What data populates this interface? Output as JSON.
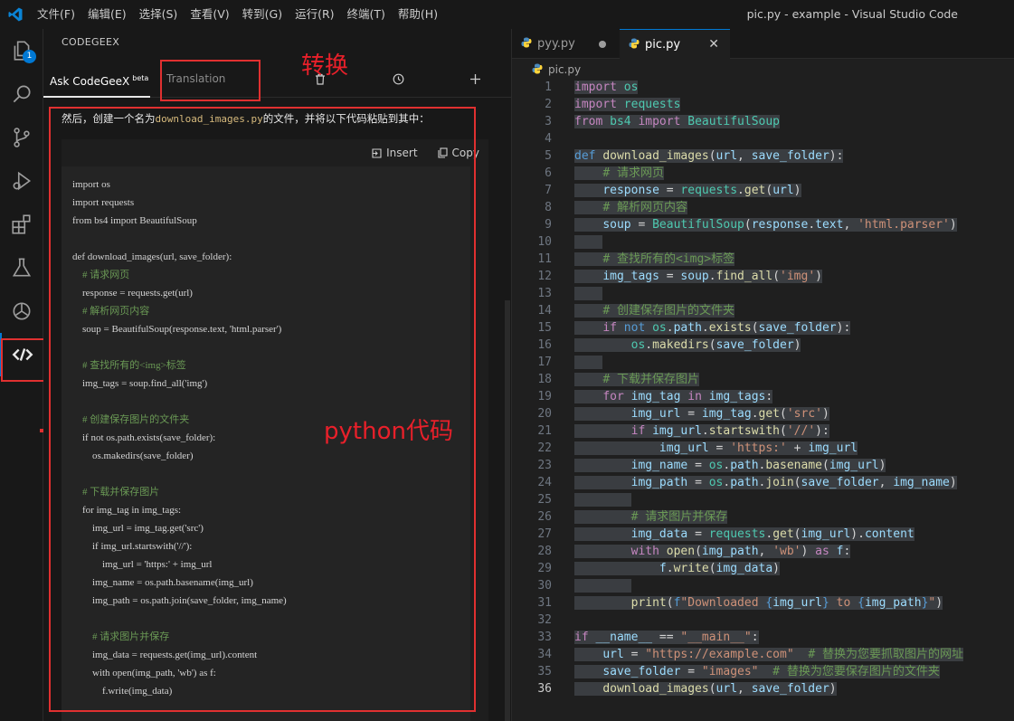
{
  "titlebar": {
    "menus": [
      "文件(F)",
      "编辑(E)",
      "选择(S)",
      "查看(V)",
      "转到(G)",
      "运行(R)",
      "终端(T)",
      "帮助(H)"
    ],
    "window_title": "pic.py - example - Visual Studio Code"
  },
  "activitybar": {
    "badge": "1"
  },
  "sidepanel": {
    "title": "CODEGEEX",
    "tab_ask": "Ask CodeGeeX",
    "tab_ask_sup": "beta",
    "tab_translation": "Translation",
    "annotation_convert": "转换",
    "annotation_python": "python代码",
    "intro_prefix": "然后，创建一个名为",
    "intro_filename": "download_images.py",
    "intro_suffix": "的文件，并将以下代码粘贴到其中：",
    "insert_label": "Insert",
    "copy_label": "Copy",
    "code_lines": [
      "import os",
      "import requests",
      "from bs4 import BeautifulSoup",
      "",
      "def download_images(url, save_folder):",
      "    # 请求网页",
      "    response = requests.get(url)",
      "    # 解析网页内容",
      "    soup = BeautifulSoup(response.text, 'html.parser')",
      "",
      "    # 查找所有的<img>标签",
      "    img_tags = soup.find_all('img')",
      "",
      "    # 创建保存图片的文件夹",
      "    if not os.path.exists(save_folder):",
      "        os.makedirs(save_folder)",
      "",
      "    # 下载并保存图片",
      "    for img_tag in img_tags:",
      "        img_url = img_tag.get('src')",
      "        if img_url.startswith('//'):",
      "            img_url = 'https:' + img_url",
      "        img_name = os.path.basename(img_url)",
      "        img_path = os.path.join(save_folder, img_name)",
      "",
      "        # 请求图片并保存",
      "        img_data = requests.get(img_url).content",
      "        with open(img_path, 'wb') as f:",
      "            f.write(img_data)"
    ]
  },
  "editor": {
    "tab1": "pyy.py",
    "tab2": "pic.py",
    "breadcrumb": "pic.py",
    "current_line": "36",
    "line_numbers": [
      "1",
      "2",
      "3",
      "4",
      "5",
      "6",
      "7",
      "8",
      "9",
      "10",
      "11",
      "12",
      "13",
      "14",
      "15",
      "16",
      "17",
      "18",
      "19",
      "20",
      "21",
      "22",
      "23",
      "24",
      "25",
      "26",
      "27",
      "28",
      "29",
      "30",
      "31",
      "32",
      "33",
      "34",
      "35",
      "36"
    ]
  },
  "colors": {
    "accent": "#0078d4",
    "annotation_red": "#e03030"
  }
}
